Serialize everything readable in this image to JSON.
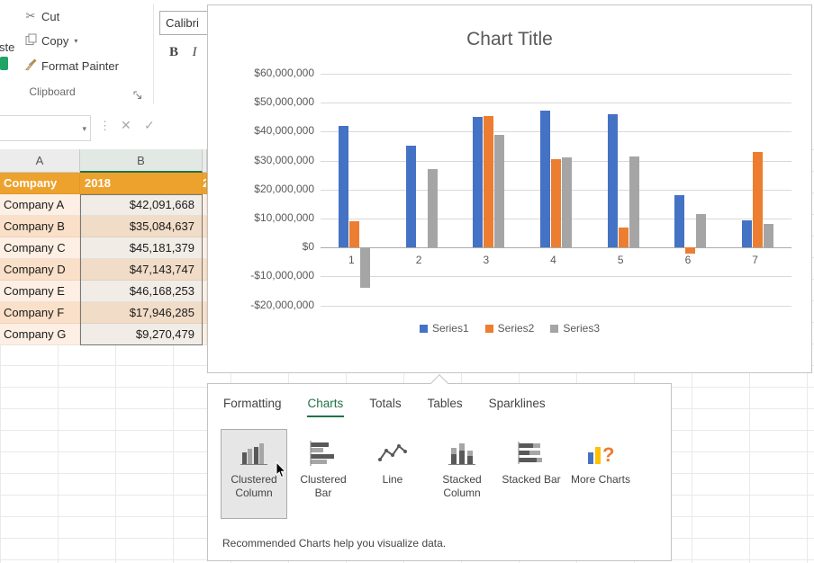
{
  "ribbon": {
    "paste_fragment": "ste",
    "cut_label": "Cut",
    "copy_label": "Copy",
    "format_painter_label": "Format Painter",
    "group_label": "Clipboard",
    "font_name": "Calibri",
    "bold_label": "B",
    "italic_label": "I"
  },
  "spreadsheet": {
    "column_headers": [
      "A",
      "B"
    ],
    "next_column_fragment": "2",
    "table_header": {
      "name": "Company",
      "year": "2018"
    },
    "rows": [
      {
        "name": "Company A",
        "value": "$42,091,668"
      },
      {
        "name": "Company B",
        "value": "$35,084,637"
      },
      {
        "name": "Company C",
        "value": "$45,181,379"
      },
      {
        "name": "Company D",
        "value": "$47,143,747"
      },
      {
        "name": "Company E",
        "value": "$46,168,253"
      },
      {
        "name": "Company F",
        "value": "$17,946,285"
      },
      {
        "name": "Company G",
        "value": "$9,270,479"
      }
    ]
  },
  "chart_data": {
    "type": "bar",
    "title": "Chart Title",
    "categories": [
      "1",
      "2",
      "3",
      "4",
      "5",
      "6",
      "7"
    ],
    "series": [
      {
        "name": "Series1",
        "color": "#4472C4",
        "values": [
          42091668,
          35084637,
          45181379,
          47143747,
          46168253,
          17946285,
          9270479
        ]
      },
      {
        "name": "Series2",
        "color": "#ED7D31",
        "values": [
          9000000,
          0,
          45500000,
          30500000,
          7000000,
          -2000000,
          33000000
        ]
      },
      {
        "name": "Series3",
        "color": "#A5A5A5",
        "values": [
          -14000000,
          27000000,
          39000000,
          31000000,
          31500000,
          11500000,
          8000000
        ]
      }
    ],
    "ylim": [
      -20000000,
      60000000
    ],
    "ytick_values": [
      60000000,
      50000000,
      40000000,
      30000000,
      20000000,
      10000000,
      0,
      -10000000,
      -20000000
    ],
    "ytick_labels": [
      "$60,000,000",
      "$50,000,000",
      "$40,000,000",
      "$30,000,000",
      "$20,000,000",
      "$10,000,000",
      "$0",
      "-$10,000,000",
      "-$20,000,000"
    ],
    "legend_position": "bottom",
    "grid": true
  },
  "quick_analysis": {
    "tabs": [
      {
        "id": "formatting",
        "label": "Formatting",
        "active": false
      },
      {
        "id": "charts",
        "label": "Charts",
        "active": true
      },
      {
        "id": "totals",
        "label": "Totals",
        "active": false
      },
      {
        "id": "tables",
        "label": "Tables",
        "active": false
      },
      {
        "id": "sparklines",
        "label": "Sparklines",
        "active": false
      }
    ],
    "buttons": [
      {
        "id": "clustered-column",
        "label": "Clustered Column",
        "active": true
      },
      {
        "id": "clustered-bar",
        "label": "Clustered Bar",
        "active": false
      },
      {
        "id": "line",
        "label": "Line",
        "active": false
      },
      {
        "id": "stacked-column",
        "label": "Stacked Column",
        "active": false
      },
      {
        "id": "stacked-bar",
        "label": "Stacked Bar",
        "active": false
      },
      {
        "id": "more-charts",
        "label": "More Charts",
        "active": false
      }
    ],
    "footer": "Recommended Charts help you visualize data."
  },
  "colors": {
    "excel_green": "#217346",
    "table_header_fill": "#EDA22D",
    "band_light": "#FDEFE3",
    "band_dark": "#FAE0C8",
    "series1": "#4472C4",
    "series2": "#ED7D31",
    "series3": "#A5A5A5"
  }
}
